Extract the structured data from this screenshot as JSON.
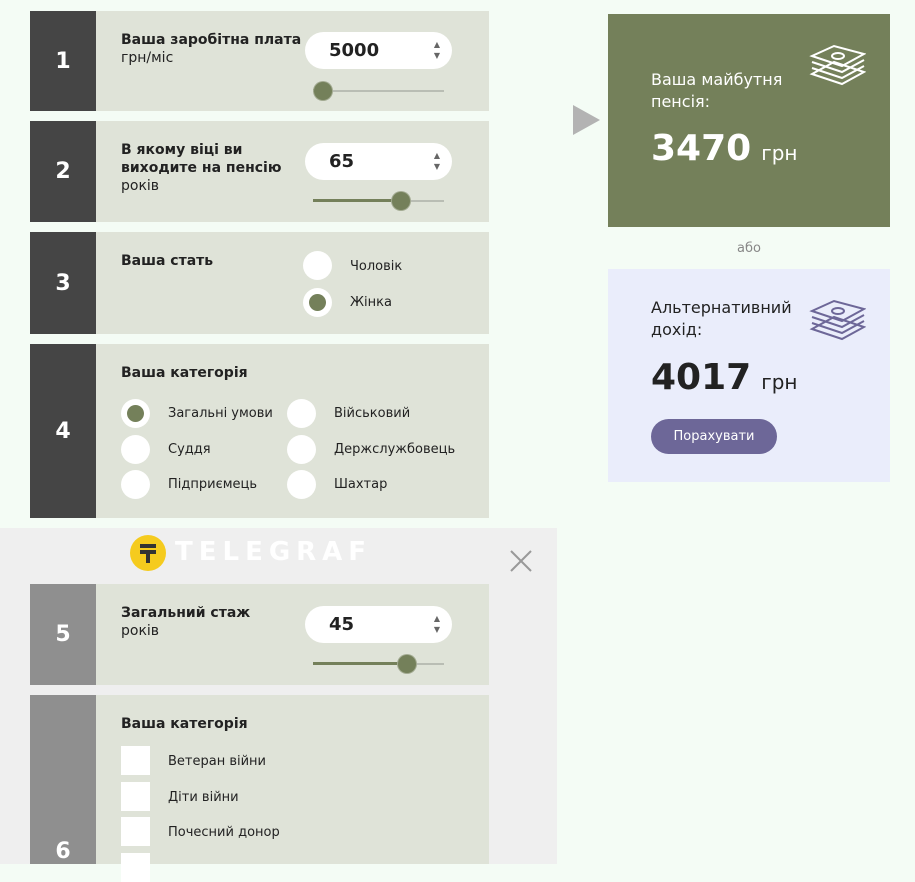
{
  "steps": [
    {
      "number": "1",
      "label": "Ваша заробітна плата",
      "unit": "грн/міс",
      "value": "5000",
      "slider_fraction": 0.0
    },
    {
      "number": "2",
      "label": "В якому віці ви виходите на пенсію",
      "unit": "років",
      "value": "65",
      "slider_fraction": 0.7
    },
    {
      "number": "3",
      "label": "Ваша стать"
    },
    {
      "number": "4",
      "label": "Ваша категорія"
    },
    {
      "number": "5",
      "label": "Загальний стаж",
      "unit": "років",
      "value": "45",
      "slider_fraction": 0.76
    },
    {
      "number": "6",
      "label": "Ваша категорія"
    }
  ],
  "gender_options": [
    "Чоловік",
    "Жінка"
  ],
  "gender_selected": "Жінка",
  "category_options": [
    "Загальні умови",
    "Військовий",
    "Суддя",
    "Держслужбовець",
    "Підприємець",
    "Шахтар"
  ],
  "category_selected": "Загальні умови",
  "checkbox_options": [
    "Ветеран війни",
    "Діти війни",
    "Почесний донор"
  ],
  "overlay": {
    "brand": "TELEGRAF"
  },
  "results": {
    "pension_title": "Ваша майбутня пенсія:",
    "pension_amount": "3470",
    "currency": "грн",
    "or_text": "або",
    "alt_title": "Альтернативний дохід:",
    "alt_amount": "4017",
    "calculate_label": "Порахувати"
  },
  "colors": {
    "panel": "#dfe3d8",
    "number_bg": "#454545",
    "accent_green": "#74805a",
    "alt_bg": "#eaedfb",
    "button": "#6d6798"
  },
  "icons": [
    "money-stack-icon",
    "close-icon",
    "play-arrow-icon",
    "telegraf-logo-icon"
  ]
}
